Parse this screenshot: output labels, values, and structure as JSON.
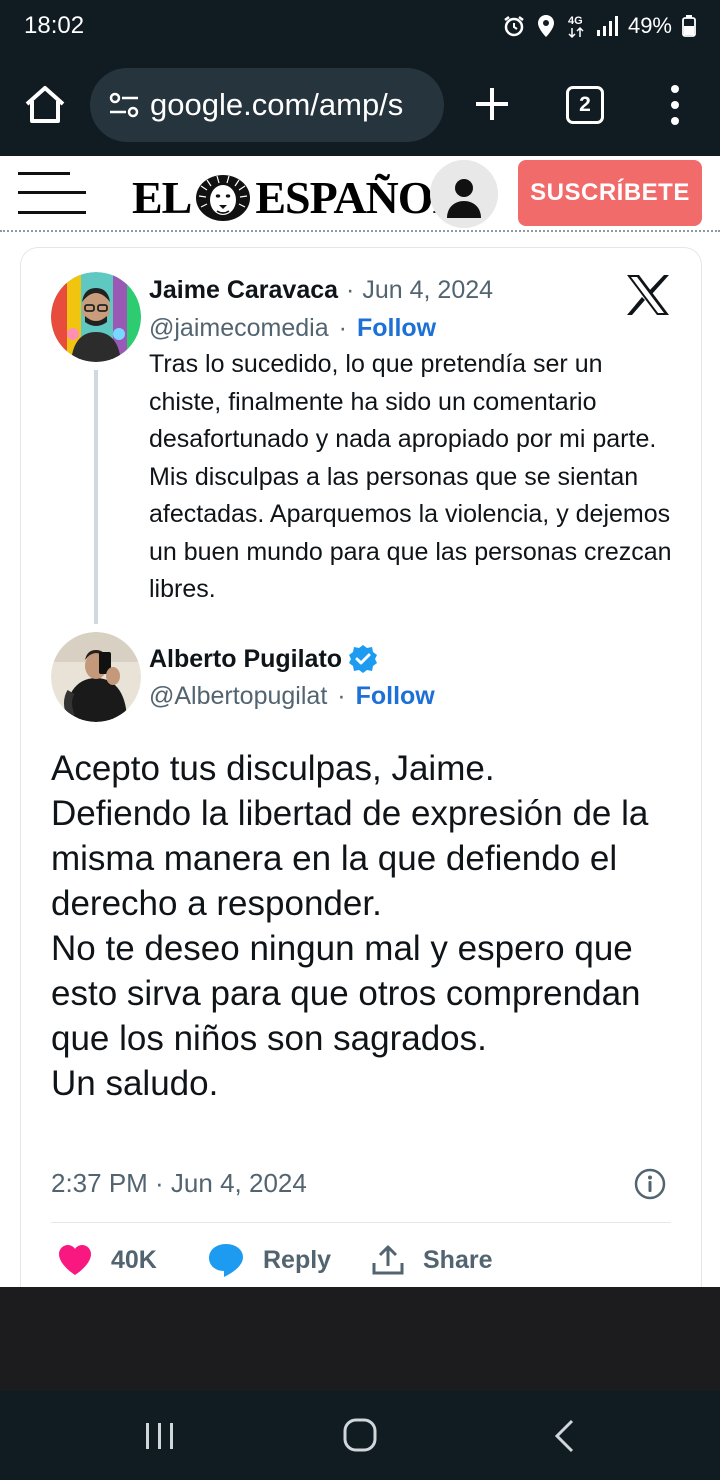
{
  "status_bar": {
    "time": "18:02",
    "network": "4G",
    "battery": "49%",
    "icons": [
      "alarm-icon",
      "location-icon",
      "data-icon",
      "signal-icon",
      "battery-icon"
    ]
  },
  "browser": {
    "url": "google.com/amp/s",
    "tab_count": "2",
    "icons": [
      "home-icon",
      "site-settings-icon",
      "new-tab-icon",
      "tabs-icon",
      "menu-icon"
    ]
  },
  "site": {
    "logo_left": "EL",
    "logo_right": "ESPAÑOL",
    "subscribe_label": "SUSCRÍBETE",
    "icons": [
      "hamburger-icon",
      "lion-logo",
      "account-icon"
    ]
  },
  "tweet": {
    "parent": {
      "name": "Jaime Caravaca",
      "separator": "·",
      "date": "Jun 4, 2024",
      "handle": "@jaimecomedia",
      "follow_label": "Follow",
      "text": "Tras lo sucedido, lo que pretendía ser un chiste, finalmente ha sido un comentario desafortunado y nada apropiado por mi parte. Mis disculpas a las personas que se sientan afectadas. Aparquemos la violencia, y dejemos un buen mundo para que las personas crezcan libres."
    },
    "main": {
      "name": "Alberto Pugilato",
      "verified": true,
      "handle": "@Albertopugilat",
      "separator": "·",
      "follow_label": "Follow",
      "lines": [
        "Acepto tus disculpas, Jaime.",
        "Defiendo la libertad de expresión de la misma manera en la que defiendo el derecho a responder.",
        "No te deseo ningun mal y espero que esto sirva para que otros comprendan que los niños son sagrados.",
        "Un saludo."
      ],
      "timestamp": "2:37 PM · Jun 4, 2024"
    },
    "actions": {
      "like_count": "40K",
      "reply_label": "Reply",
      "share_label": "Share"
    },
    "colors": {
      "follow": "#1d70d6",
      "like": "#f91880",
      "reply": "#1d9bf0",
      "verified": "#1d9bf0",
      "muted": "#536471"
    }
  },
  "nav": {
    "icons": [
      "recent-apps-icon",
      "home-circle-icon",
      "back-icon"
    ]
  }
}
